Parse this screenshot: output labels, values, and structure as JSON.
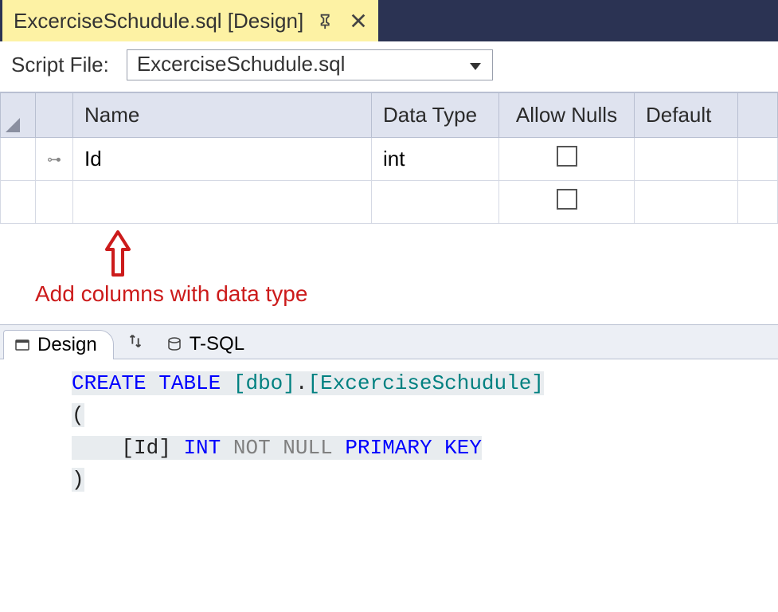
{
  "tab": {
    "title": "ExcerciseSchudule.sql [Design]"
  },
  "scriptFile": {
    "label": "Script File:",
    "value": "ExcerciseSchudule.sql"
  },
  "columns": {
    "headers": {
      "name": "Name",
      "dataType": "Data Type",
      "allowNulls": "Allow Nulls",
      "default": "Default"
    },
    "rows": [
      {
        "isKey": true,
        "name": "Id",
        "dataType": "int",
        "allowNulls": false,
        "default": ""
      },
      {
        "isKey": false,
        "name": "",
        "dataType": "",
        "allowNulls": false,
        "default": ""
      }
    ]
  },
  "annotation": "Add columns with data type",
  "lowerTabs": {
    "design": "Design",
    "tsql": "T-SQL"
  },
  "sql": {
    "create": "CREATE",
    "table": "TABLE",
    "schema": "[dbo]",
    "dot": ".",
    "tableName": "[ExcerciseSchudule]",
    "lparen": "(",
    "col": "[Id]",
    "int": "INT",
    "not": "NOT",
    "null": "NULL",
    "primary": "PRIMARY",
    "key": "KEY",
    "rparen": ")"
  }
}
